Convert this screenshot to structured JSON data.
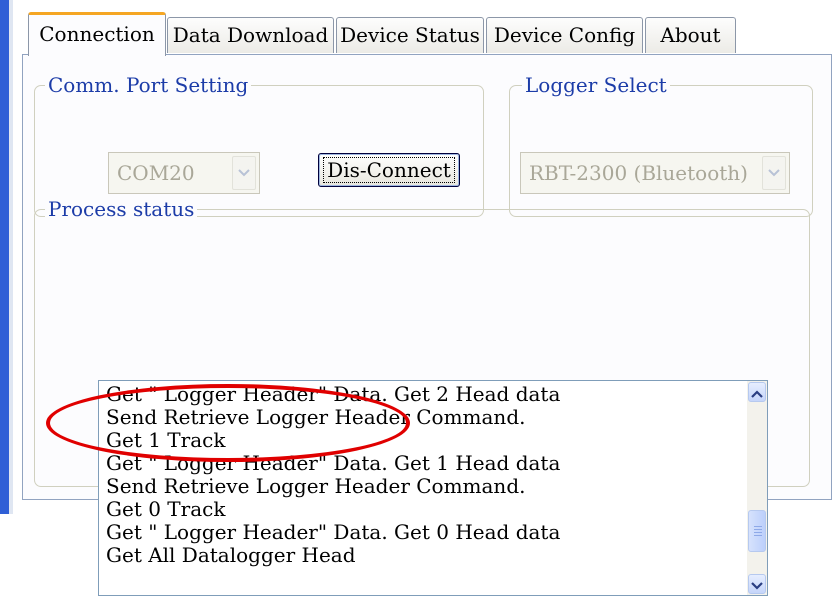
{
  "tabs": [
    {
      "label": "Connection",
      "active": true
    },
    {
      "label": "Data Download",
      "active": false
    },
    {
      "label": "Device Status",
      "active": false
    },
    {
      "label": "Device Config",
      "active": false
    },
    {
      "label": "About",
      "active": false
    }
  ],
  "comm_port": {
    "title": "Comm. Port Setting",
    "port_value": "COM20",
    "enabled": false,
    "disconnect_label": "Dis-Connect"
  },
  "logger_select": {
    "title": "Logger Select",
    "value": "RBT-2300 (Bluetooth)",
    "enabled": false
  },
  "process_status": {
    "title": "Process status",
    "lines": [
      "Get \" Logger Header\" Data. Get 2 Head data",
      "Send Retrieve Logger Header Command.",
      "Get 1  Track",
      "Get \" Logger Header\" Data. Get 1 Head data",
      "Send Retrieve Logger Header Command.",
      "Get 0  Track",
      "Get \" Logger Header\" Data. Get 0 Head data",
      "Get All Datalogger Head"
    ]
  },
  "icons": {
    "dropdown": "chevron-down-icon",
    "scroll_up": "chevron-up-icon",
    "scroll_down": "chevron-down-icon"
  },
  "colors": {
    "group_title": "#1c3ca8",
    "active_tab_accent": "#f5a623",
    "annotation": "#e00000"
  }
}
